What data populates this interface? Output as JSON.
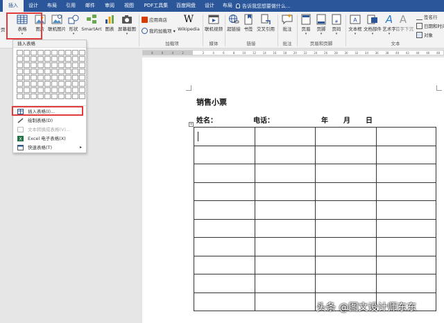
{
  "tabs": [
    {
      "label": "插入",
      "active": true
    },
    {
      "label": "设计"
    },
    {
      "label": "布局"
    },
    {
      "label": "引用"
    },
    {
      "label": "邮件"
    },
    {
      "label": "审阅"
    },
    {
      "label": "视图"
    },
    {
      "label": "PDF工具集"
    },
    {
      "label": "百度网盘"
    },
    {
      "label": "设计"
    },
    {
      "label": "布局"
    }
  ],
  "tell_me": "告诉我您想要做什么...",
  "ribbon": {
    "cut_left": "分页",
    "table": "表格",
    "picture": "图片",
    "online_picture": "联机图片",
    "shapes": "形状",
    "smartart": "SmartArt",
    "chart": "图表",
    "screenshot": "屏幕截图",
    "app_store": "应用商店",
    "my_addins": "我的加载项",
    "wikipedia": "Wikipedia",
    "online_video": "联机视频",
    "hyperlink": "超链接",
    "bookmark": "书签",
    "cross_ref": "交叉引用",
    "comment": "批注",
    "header": "页眉",
    "footer": "页脚",
    "page_number": "页码",
    "textbox": "文本框",
    "doc_parts": "文档部件",
    "wordart": "艺术字",
    "drop_cap": "首字下沉",
    "signature": "签名行",
    "datetime": "日期和时间",
    "object": "对象",
    "groups": {
      "addins": "加载项",
      "media": "媒体",
      "links": "链接",
      "comments": "批注",
      "header_footer": "页眉和页脚",
      "text": "文本"
    }
  },
  "ruler_ticks": [
    "8",
    "6",
    "4",
    "2",
    "",
    "2",
    "4",
    "6",
    "8",
    "10",
    "12",
    "14",
    "16",
    "18",
    "20",
    "22",
    "24",
    "26",
    "28",
    "30",
    "32",
    "34",
    "36",
    "38",
    "40",
    "42",
    "44",
    "46",
    "48"
  ],
  "dropdown": {
    "header": "插入表格",
    "items": [
      {
        "label": "插入表格(I)...",
        "disabled": false
      },
      {
        "label": "绘制表格(D)",
        "disabled": false
      },
      {
        "label": "文本转换成表格(V)...",
        "disabled": true
      },
      {
        "label": "Excel 电子表格(X)",
        "disabled": false
      },
      {
        "label": "快速表格(T)",
        "disabled": false,
        "submenu": true
      }
    ]
  },
  "document": {
    "title": "销售小票",
    "name_label": "姓名：",
    "phone_label": "电话：",
    "year": "年",
    "month": "月",
    "day": "日",
    "table_rows": 10,
    "table_cols": 4
  },
  "watermark": "头条 @图文设计师东东",
  "colors": {
    "accent": "#2b579a",
    "highlight": "#e03c3c"
  }
}
